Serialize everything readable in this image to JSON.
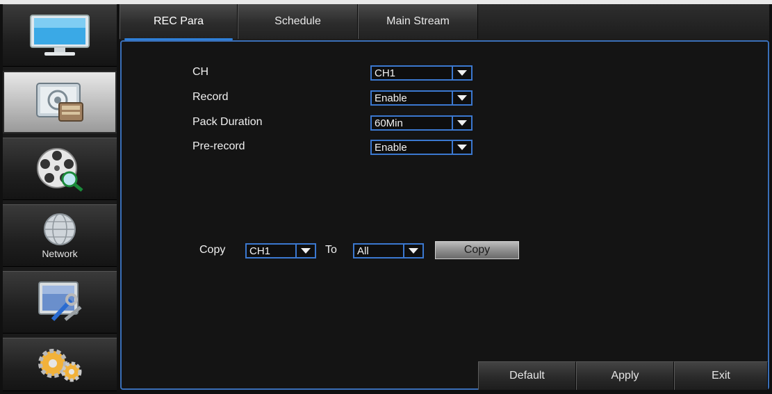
{
  "sidebar": {
    "items": [
      {
        "icon": "monitor-icon",
        "label": "",
        "active": false
      },
      {
        "icon": "record-settings-icon",
        "label": "",
        "active": true
      },
      {
        "icon": "film-reel-search-icon",
        "label": "",
        "active": false
      },
      {
        "icon": "globe-icon",
        "label": "Network",
        "active": false
      },
      {
        "icon": "system-tools-icon",
        "label": "",
        "active": false
      },
      {
        "icon": "gears-icon",
        "label": "",
        "active": false
      }
    ]
  },
  "tabs": [
    {
      "label": "REC Para",
      "active": true
    },
    {
      "label": "Schedule",
      "active": false
    },
    {
      "label": "Main Stream",
      "active": false
    }
  ],
  "form": {
    "ch": {
      "label": "CH",
      "value": "CH1"
    },
    "record": {
      "label": "Record",
      "value": "Enable"
    },
    "pack_duration": {
      "label": "Pack Duration",
      "value": "60Min"
    },
    "pre_record": {
      "label": "Pre-record",
      "value": "Enable"
    }
  },
  "copy": {
    "label": "Copy",
    "from_value": "CH1",
    "to_label": "To",
    "to_value": "All",
    "button_label": "Copy"
  },
  "buttons": {
    "default": "Default",
    "apply": "Apply",
    "exit": "Exit"
  },
  "colors": {
    "accent": "#3b78d0",
    "panel_border": "#3a6fb8",
    "text": "#f0f0f0"
  }
}
